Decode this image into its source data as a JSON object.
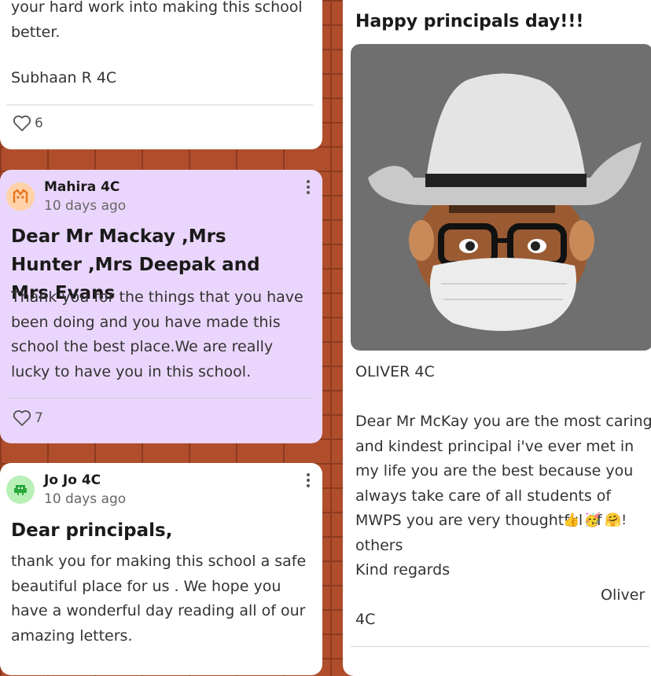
{
  "card1": {
    "body_top": "your hard work into making this school\nbetter.",
    "signature": "Subhaan R 4C",
    "likes": "6"
  },
  "card2": {
    "author": "Mahira 4C",
    "time": "10 days ago",
    "title": "Dear Mr Mackay ,Mrs Hunter ,Mrs Deepak and Mrs Evans",
    "body": "Thank you for the things that you have been doing and you have made this school the best place.We are really lucky to have you in this school.",
    "likes": "7",
    "avatar_color": "#ffd2a8"
  },
  "card3": {
    "author": "Jo Jo 4C",
    "time": "10 days ago",
    "title": "Dear principals,",
    "body": "thank you for making this school a safe beautiful place for us . We hope you have a wonderful day reading all of our amazing letters.",
    "avatar_color": "#b8f0b8"
  },
  "card4": {
    "title": "Happy principals day!!!",
    "signature_line": "OLIVER 4C",
    "body": "Dear Mr McKay you are the most caring and kindest principal i've ever met in my life you are the best because you always take care of all students of MWPS you are very thoughtful of others",
    "emojis": "👍 🥳 🤗!",
    "closing": "Kind regards",
    "name": "Oliver",
    "class": "4C"
  },
  "icons": {
    "heart": "heart-outline-icon",
    "kebab": "more-options-icon"
  }
}
